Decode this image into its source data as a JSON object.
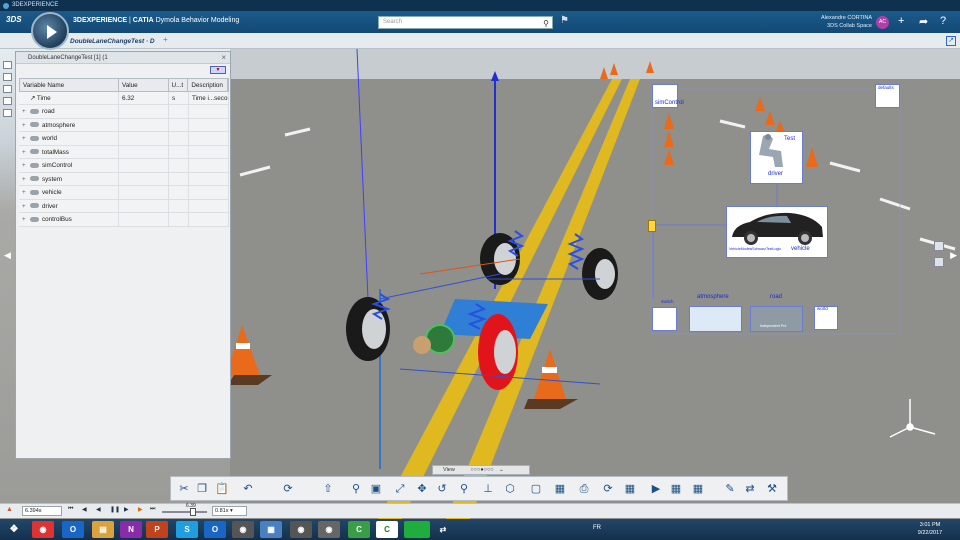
{
  "window": {
    "title": "3DEXPERIENCE"
  },
  "header": {
    "brand_app": "3DEXPERIENCE",
    "brand_sep": " | ",
    "brand_product": "CATIA",
    "brand_role": " Dymola Behavior Modeling",
    "search_placeholder": "Search",
    "user_name": "Alexandre CORTINA",
    "user_space": "3DS Collab Space",
    "avatar_initials": "AC"
  },
  "tabs": [
    {
      "label": "DoubleLaneChangeTest · D"
    }
  ],
  "panel": {
    "title": "DoubleLaneChangeTest [1] (1",
    "columns": [
      "Variable Name",
      "Value",
      "U...t",
      "Description"
    ],
    "rows": [
      {
        "name": "Time",
        "value": "6.32",
        "unit": "s",
        "desc": "Time i...secor"
      },
      {
        "name": "road",
        "value": "",
        "unit": "",
        "desc": ""
      },
      {
        "name": "atmosphere",
        "value": "",
        "unit": "",
        "desc": ""
      },
      {
        "name": "world",
        "value": "",
        "unit": "",
        "desc": ""
      },
      {
        "name": "totalMass",
        "value": "",
        "unit": "",
        "desc": ""
      },
      {
        "name": "simControl",
        "value": "",
        "unit": "",
        "desc": ""
      },
      {
        "name": "system",
        "value": "",
        "unit": "",
        "desc": ""
      },
      {
        "name": "vehicle",
        "value": "",
        "unit": "",
        "desc": ""
      },
      {
        "name": "driver",
        "value": "",
        "unit": "",
        "desc": ""
      },
      {
        "name": "controlBus",
        "value": "",
        "unit": "",
        "desc": ""
      }
    ]
  },
  "diagram": {
    "simcontrol": "simControl",
    "test": "Test",
    "driver": "driver",
    "vehicle": "vehicle",
    "vehicle_caption": "VehicleModelsSchwarzTestLogic",
    "atmosphere": "atmosphere",
    "road": "road",
    "road_caption": "Independent Pnt",
    "defaults": "defaults",
    "switch": "switch",
    "world": "world"
  },
  "viewbar": {
    "label": "View"
  },
  "player": {
    "time_value": "6.394s",
    "slider_value": "6.39",
    "speed": "0.81x"
  },
  "taskbar": {
    "language": "FR",
    "time": "3:01 PM",
    "date": "9/22/2017"
  },
  "colors": {
    "header": "#1b5a8a",
    "road_line": "#e0b81f",
    "chassis": "#2f7fd6",
    "wheel_red": "#e2141b",
    "cone": "#e86a1a"
  }
}
